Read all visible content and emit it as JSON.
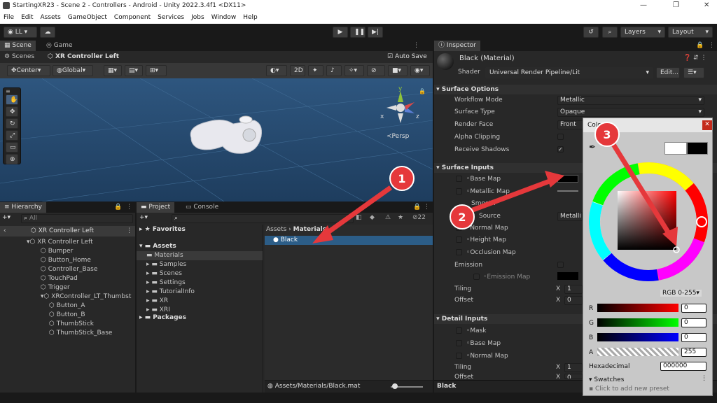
{
  "window": {
    "title": "StartingXR23 - Scene 2 - Controllers - Android - Unity 2022.3.4f1 <DX11>"
  },
  "menu": [
    "File",
    "Edit",
    "Assets",
    "GameObject",
    "Component",
    "Services",
    "Jobs",
    "Window",
    "Help"
  ],
  "toolbar": {
    "account": "LL",
    "layers": "Layers",
    "layout": "Layout"
  },
  "scene": {
    "tab_scene": "Scene",
    "tab_game": "Game",
    "scenes_label": "Scenes",
    "breadcrumb": "XR Controller Left",
    "auto_save": "Auto Save",
    "pivot": "Center",
    "space": "Global",
    "mode_2d": "2D",
    "persp": "Persp",
    "axis_x": "x",
    "axis_y": "y",
    "axis_z": "z"
  },
  "hierarchy": {
    "tab": "Hierarchy",
    "search_placeholder": "All",
    "root": "XR Controller Left",
    "items": [
      "XR Controller Left",
      "Bumper",
      "Button_Home",
      "Controller_Base",
      "TouchPad",
      "Trigger",
      "XRController_LT_Thumbst",
      "Button_A",
      "Button_B",
      "ThumbStick",
      "ThumbStick_Base"
    ]
  },
  "project": {
    "tab": "Project",
    "console_tab": "Console",
    "count": "22",
    "favorites": "Favorites",
    "assets": "Assets",
    "folders": [
      "Materials",
      "Samples",
      "Scenes",
      "Settings",
      "TutorialInfo",
      "XR",
      "XRI"
    ],
    "packages": "Packages",
    "path_a": "Assets",
    "path_b": "Materials",
    "asset": "Black",
    "footer_path": "Assets/Materials/Black.mat"
  },
  "inspector": {
    "tab": "Inspector",
    "title": "Black (Material)",
    "shader_label": "Shader",
    "shader_value": "Universal Render Pipeline/Lit",
    "edit_btn": "Edit...",
    "surface_options": "Surface Options",
    "workflow_label": "Workflow Mode",
    "workflow_value": "Metallic",
    "surface_type_label": "Surface Type",
    "surface_type_value": "Opaque",
    "render_face_label": "Render Face",
    "render_face_value": "Front",
    "alpha_clip": "Alpha Clipping",
    "receive_shadows": "Receive Shadows",
    "surface_inputs": "Surface Inputs",
    "base_map": "Base Map",
    "metallic_map": "Metallic Map",
    "smooth": "Smooth",
    "source": "Source",
    "source_value": "Metalli",
    "normal_map": "Normal Map",
    "height_map": "Height Map",
    "occlusion_map": "Occlusion Map",
    "emission": "Emission",
    "emission_map": "Emission Map",
    "tiling": "Tiling",
    "offset": "Offset",
    "x_label": "X",
    "tiling_x": "1",
    "offset_x": "0",
    "detail_inputs": "Detail Inputs",
    "mask": "Mask",
    "detail_base_map": "Base Map",
    "detail_normal_map": "Normal Map",
    "detail_tiling": "Tiling",
    "detail_offset": "Offset",
    "detail_tiling_x": "1",
    "detail_offset_x": "0",
    "footer": "Black"
  },
  "color_picker": {
    "title": "Colo",
    "mode": "RGB 0-255",
    "r_label": "R",
    "g_label": "G",
    "b_label": "B",
    "a_label": "A",
    "r": "0",
    "g": "0",
    "b": "0",
    "a": "255",
    "hex_label": "Hexadecimal",
    "hex": "000000",
    "swatches": "Swatches",
    "add_preset": "Click to add new preset"
  },
  "callouts": [
    "1",
    "2",
    "3"
  ],
  "colors": {
    "callout": "#e5383b",
    "accent_select": "#2c5d87"
  }
}
